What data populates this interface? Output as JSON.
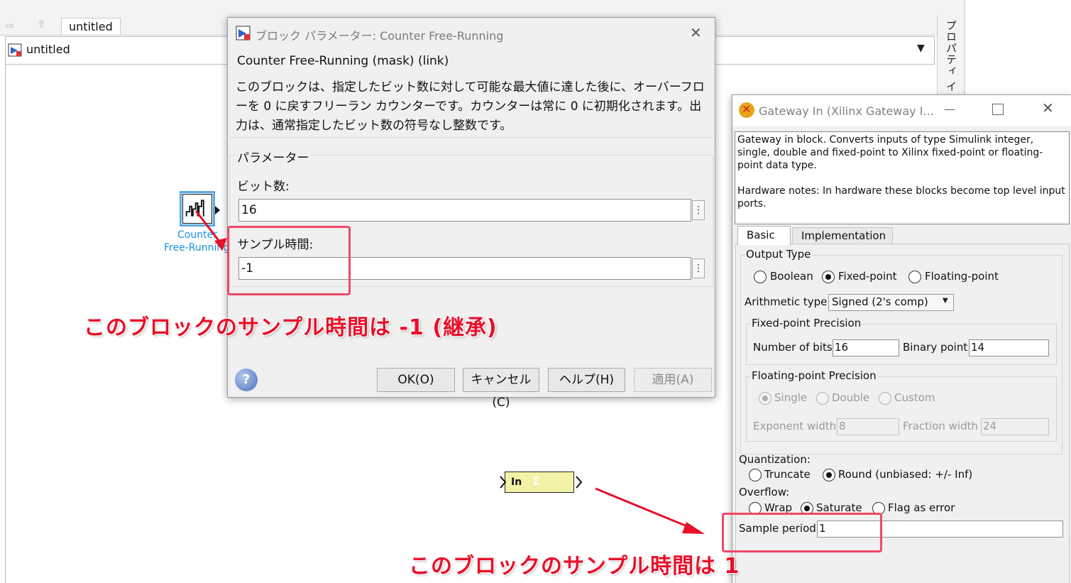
{
  "model": {
    "tab_label": "untitled",
    "address": "untitled",
    "side_panel_label": "プロパティ インス",
    "counter_block": {
      "label_line1": "Counter",
      "label_line2": "Free-Running"
    },
    "gateway_block": {
      "label": "In",
      "logo": "Σ"
    }
  },
  "block_params_dialog": {
    "title": "ブロック パラメーター: Counter Free-Running",
    "mask_title": "Counter Free-Running (mask) (link)",
    "description": "このブロックは、指定したビット数に対して可能な最大値に達した後に、オーバーフローを 0 に戻すフリーラン カウンターです。カウンターは常に 0 に初期化されます。出力は、通常指定したビット数の符号なし整数です。",
    "params_title": "パラメーター",
    "bits_label": "ビット数:",
    "bits_value": "16",
    "sample_time_label": "サンプル時間:",
    "sample_time_value": "-1",
    "menu_glyph": "⋮",
    "help_glyph": "?",
    "buttons": {
      "ok": "OK(O)",
      "cancel": "キャンセル(C)",
      "help": "ヘルプ(H)",
      "apply": "適用(A)"
    }
  },
  "gateway_dialog": {
    "title": "Gateway In (Xilinx Gateway I...",
    "description": "Gateway in block. Converts inputs of type Simulink integer, single, double and fixed-point to Xilinx fixed-point or floating-point data type.\n\nHardware notes: In hardware these blocks become top level input ports.",
    "tabs": [
      "Basic",
      "Implementation"
    ],
    "output_type": {
      "title": "Output Type",
      "options": [
        "Boolean",
        "Fixed-point",
        "Floating-point"
      ],
      "selected": "Fixed-point"
    },
    "arithmetic_type": {
      "label": "Arithmetic type",
      "value": "Signed  (2's comp)"
    },
    "fixed_precision": {
      "title": "Fixed-point Precision",
      "bits_label": "Number of bits",
      "bits_value": "16",
      "binpoint_label": "Binary point",
      "binpoint_value": "14"
    },
    "float_precision": {
      "title": "Floating-point Precision",
      "options": [
        "Single",
        "Double",
        "Custom"
      ],
      "selected": "Single",
      "exp_label": "Exponent width",
      "exp_value": "8",
      "frac_label": "Fraction width",
      "frac_value": "24"
    },
    "quantization": {
      "label": "Quantization:",
      "options": [
        "Truncate",
        "Round  (unbiased: +/- Inf)"
      ],
      "selected": "Round  (unbiased: +/- Inf)"
    },
    "overflow": {
      "label": "Overflow:",
      "options": [
        "Wrap",
        "Saturate",
        "Flag as error"
      ],
      "selected": "Saturate"
    },
    "sample_period": {
      "label": "Sample period",
      "value": "1"
    }
  },
  "annotations": {
    "counter_note": "このブロックのサンプル時間は -1 (継承)",
    "gateway_note": "このブロックのサンプル時間は 1"
  },
  "colors": {
    "annotation": "#e8102a",
    "highlight_box": "#ef4868",
    "link_blue": "#1a8fdc",
    "gateway_fill": "#f4f2a6"
  }
}
